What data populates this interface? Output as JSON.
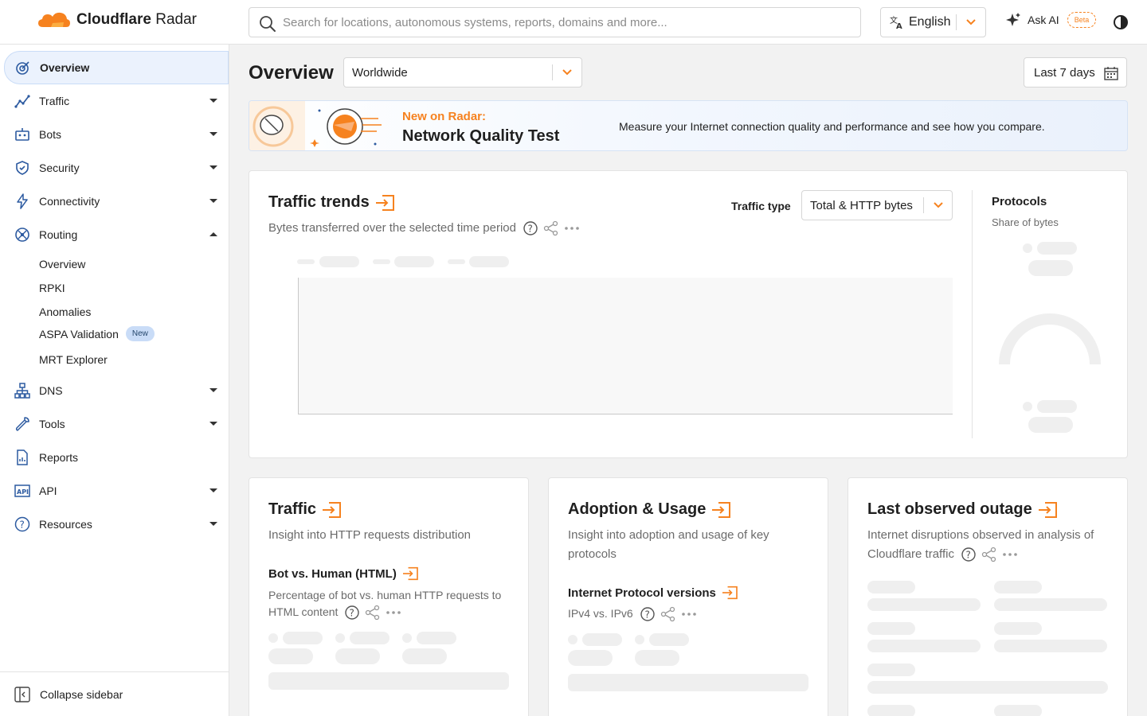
{
  "header": {
    "logo_text_bold": "Cloudflare",
    "logo_text_light": " Radar",
    "search_placeholder": "Search for locations, autonomous systems, reports, domains and more...",
    "language": "English",
    "ask_ai": "Ask AI",
    "beta": "Beta"
  },
  "sidebar": {
    "items": [
      {
        "label": "Overview"
      },
      {
        "label": "Traffic"
      },
      {
        "label": "Bots"
      },
      {
        "label": "Security"
      },
      {
        "label": "Connectivity"
      },
      {
        "label": "Routing"
      },
      {
        "label": "DNS"
      },
      {
        "label": "Tools"
      },
      {
        "label": "Reports"
      },
      {
        "label": "API"
      },
      {
        "label": "Resources"
      }
    ],
    "routing_sub": [
      {
        "label": "Overview"
      },
      {
        "label": "RPKI"
      },
      {
        "label": "Anomalies"
      },
      {
        "label": "ASPA Validation",
        "badge": "New"
      },
      {
        "label": "MRT Explorer"
      }
    ],
    "collapse": "Collapse sidebar"
  },
  "main": {
    "title": "Overview",
    "location": "Worldwide",
    "date_range": "Last 7 days",
    "banner": {
      "kicker": "New on Radar:",
      "title": "Network Quality Test",
      "description": "Measure your Internet connection quality and performance and see how you compare."
    },
    "traffic_trends": {
      "title": "Traffic trends",
      "subtitle": "Bytes transferred over the selected time period",
      "type_label": "Traffic type",
      "type_value": "Total & HTTP bytes",
      "protocols_title": "Protocols",
      "protocols_sub": "Share of bytes"
    },
    "traffic_card": {
      "title": "Traffic",
      "subtitle": "Insight into HTTP requests distribution",
      "section_title": "Bot vs. Human (HTML)",
      "section_sub_1": "Percentage of bot vs. human HTTP requests to",
      "section_sub_2": "HTML content"
    },
    "adoption_card": {
      "title": "Adoption & Usage",
      "subtitle_1": "Insight into adoption and usage of key",
      "subtitle_2": "protocols",
      "section_title": "Internet Protocol versions",
      "section_sub": "IPv4 vs. IPv6"
    },
    "outage_card": {
      "title": "Last observed outage",
      "subtitle_1": "Internet disruptions observed in analysis of",
      "subtitle_2": "Cloudflare traffic"
    }
  },
  "colors": {
    "accent": "#f6821f",
    "active_bg": "#ebf2fd",
    "nav_icon": "#2c5aa0"
  }
}
